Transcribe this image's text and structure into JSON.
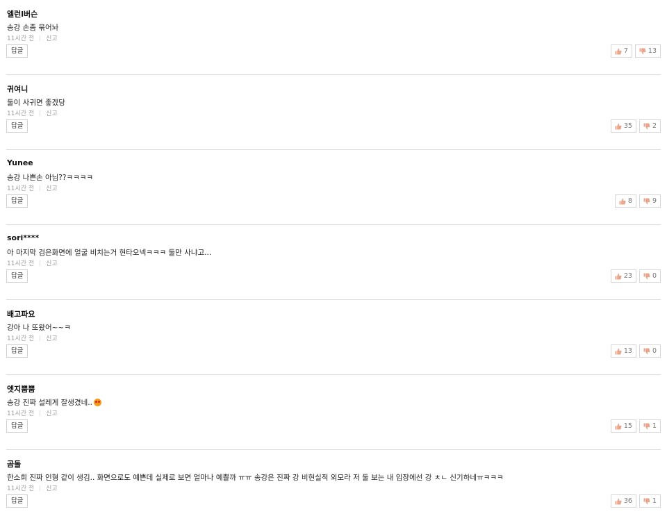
{
  "comments": [
    {
      "author": "엘런l버슨",
      "text": "송강 손좀 묶어놔",
      "time": "11시간 전",
      "report": "신고",
      "reply_label": "답글",
      "likes": "7",
      "dislikes": "13",
      "has_emoji": false
    },
    {
      "author": "귀여니",
      "text": "둘이 사귀면 좋겠당",
      "time": "11시간 전",
      "report": "신고",
      "reply_label": "답글",
      "likes": "35",
      "dislikes": "2",
      "has_emoji": false
    },
    {
      "author": "Yunee",
      "text": "송강 나쁜손 아님??ㅋㅋㅋㅋ",
      "time": "11시간 전",
      "report": "신고",
      "reply_label": "답글",
      "likes": "8",
      "dislikes": "9",
      "has_emoji": false
    },
    {
      "author": "sori****",
      "text": "아 마지막 검은화면에 얼굴 비치는거 현타오넥ㅋㅋㅋ 둘만 사냐고...",
      "time": "11시간 전",
      "report": "신고",
      "reply_label": "답글",
      "likes": "23",
      "dislikes": "0",
      "has_emoji": false
    },
    {
      "author": "배고파요",
      "text": "강아 나 또왔어~~ㅋ",
      "time": "11시간 전",
      "report": "신고",
      "reply_label": "답글",
      "likes": "13",
      "dislikes": "0",
      "has_emoji": false
    },
    {
      "author": "엣지뿜뿜",
      "text": "송강 진짜 설레게 잘생겼네..",
      "time": "11시간 전",
      "report": "신고",
      "reply_label": "답글",
      "likes": "15",
      "dislikes": "1",
      "has_emoji": true
    },
    {
      "author": "곰돌",
      "text": "한소희 진짜 인형 같이 생김.. 화면으로도 예쁜데 실제로 보면 얼마나 예쁠까 ㅠㅠ 송강은 진짜 강 비현실적 외모라 저 둘 보는 내 입장에선 강 ㅊㄴ 신기하네ㅠㅋㅋㅋ",
      "time": "11시간 전",
      "report": "신고",
      "reply_label": "답글",
      "likes": "36",
      "dislikes": "1",
      "has_emoji": false
    }
  ],
  "colors": {
    "like_icon": "#e8a58c",
    "dislike_icon": "#e8a58c",
    "divider": "#dcdcdc",
    "meta_text": "#999999"
  },
  "icons": {
    "like": "thumbs-up-icon",
    "dislike": "thumbs-down-icon",
    "emoji": "heart-eyes-emoji-icon"
  }
}
